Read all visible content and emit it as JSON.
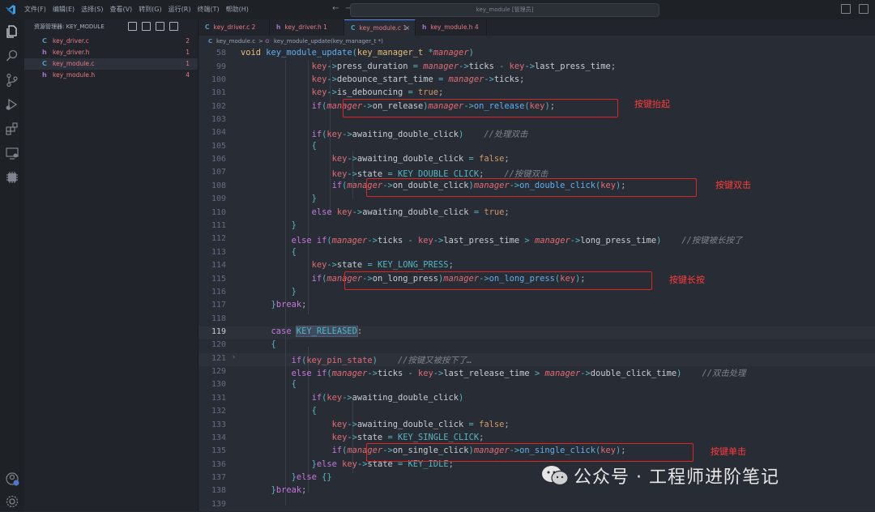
{
  "titlebar": {
    "menu": [
      "文件(F)",
      "编辑(E)",
      "选择(S)",
      "查看(V)",
      "转到(G)",
      "运行(R)",
      "终端(T)",
      "帮助(H)"
    ],
    "command_center": "key_module [管理员]",
    "nav_back": "←",
    "nav_forward": "→"
  },
  "sidebar": {
    "header": "资源管理器: KEY_MODULE",
    "files": [
      {
        "icon": "C",
        "name": "key_driver.c",
        "count": "2",
        "color": "#e87a82",
        "icon_color": "#519aba"
      },
      {
        "icon": "h",
        "name": "key_driver.h",
        "count": "1",
        "color": "#e87a82",
        "icon_color": "#a074c4"
      },
      {
        "icon": "C",
        "name": "key_module.c",
        "count": "1",
        "color": "#e87a82",
        "icon_color": "#519aba",
        "active": true
      },
      {
        "icon": "h",
        "name": "key_module.h",
        "count": "4",
        "color": "#e87a82",
        "icon_color": "#a074c4"
      }
    ]
  },
  "tabs": [
    {
      "icon": "C",
      "label": "key_driver.c 2",
      "icon_color": "#519aba"
    },
    {
      "icon": "h",
      "label": "key_driver.h 1",
      "icon_color": "#a074c4"
    },
    {
      "icon": "C",
      "label": "key_module.c 1",
      "icon_color": "#519aba",
      "active": true,
      "close": "×"
    },
    {
      "icon": "h",
      "label": "key_module.h 4",
      "icon_color": "#a074c4"
    }
  ],
  "breadcrumb": {
    "file": "key_module.c",
    "sep": ">",
    "symbol": "key_module_update(key_manager_t *)"
  },
  "gutter": [
    "58",
    "99",
    "100",
    "101",
    "102",
    "103",
    "104",
    "105",
    "106",
    "107",
    "108",
    "109",
    "110",
    "111",
    "112",
    "113",
    "114",
    "115",
    "116",
    "117",
    "118",
    "119",
    "120",
    "121",
    "129",
    "130",
    "131",
    "132",
    "133",
    "134",
    "135",
    "136",
    "137",
    "138",
    "139"
  ],
  "annotations": {
    "release": "按键抬起",
    "double_click": "按键双击",
    "long_press": "按键长按",
    "single_click": "按键单击"
  },
  "watermark": "公众号 · 工程师进阶笔记",
  "colors": {
    "accent": "#528bff",
    "annotation_red": "#e02424",
    "error_tab": "#e87a82"
  }
}
